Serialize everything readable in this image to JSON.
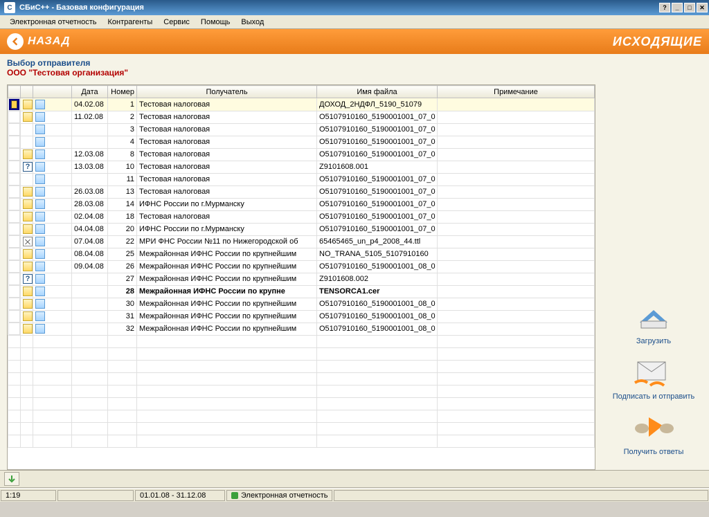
{
  "window": {
    "title": "СБиС++ - Базовая конфигурация"
  },
  "menu": [
    "Электронная отчетность",
    "Контрагенты",
    "Сервис",
    "Помощь",
    "Выход"
  ],
  "header": {
    "back": "НАЗАД",
    "section": "ИСХОДЯЩИЕ"
  },
  "info": {
    "label": "Выбор отправителя",
    "org": "ООО \"Тестовая организация\""
  },
  "columns": {
    "date": "Дата",
    "num": "Номер",
    "recipient": "Получатель",
    "file": "Имя файла",
    "note": "Примечание"
  },
  "rows": [
    {
      "ic1": "doc",
      "date": "04.02.08",
      "num": "1",
      "recipient": "Тестовая налоговая",
      "file": "ДОХОД_2НДФЛ_5190_51079",
      "selected": true
    },
    {
      "ic1": "doc",
      "date": "11.02.08",
      "num": "2",
      "recipient": "Тестовая налоговая",
      "file": "О5107910160_5190001001_07_0"
    },
    {
      "ic1": "",
      "date": "",
      "num": "3",
      "recipient": "Тестовая налоговая",
      "file": "О5107910160_5190001001_07_0"
    },
    {
      "ic1": "",
      "date": "",
      "num": "4",
      "recipient": "Тестовая налоговая",
      "file": "О5107910160_5190001001_07_0"
    },
    {
      "ic1": "doc",
      "date": "12.03.08",
      "num": "8",
      "recipient": "Тестовая налоговая",
      "file": "О5107910160_5190001001_07_0"
    },
    {
      "ic1": "q",
      "date": "13.03.08",
      "num": "10",
      "recipient": "Тестовая налоговая",
      "file": "Z9101608.001"
    },
    {
      "ic1": "",
      "date": "",
      "num": "11",
      "recipient": "Тестовая налоговая",
      "file": "О5107910160_5190001001_07_0"
    },
    {
      "ic1": "doc",
      "date": "26.03.08",
      "num": "13",
      "recipient": "Тестовая налоговая",
      "file": "О5107910160_5190001001_07_0"
    },
    {
      "ic1": "doc",
      "date": "28.03.08",
      "num": "14",
      "recipient": "ИФНС России по г.Мурманску",
      "file": "О5107910160_5190001001_07_0"
    },
    {
      "ic1": "doc",
      "date": "02.04.08",
      "num": "18",
      "recipient": "Тестовая налоговая",
      "file": "О5107910160_5190001001_07_0"
    },
    {
      "ic1": "doc",
      "date": "04.04.08",
      "num": "20",
      "recipient": "ИФНС России по г.Мурманску",
      "file": "О5107910160_5190001001_07_0"
    },
    {
      "ic1": "cross",
      "date": "07.04.08",
      "num": "22",
      "recipient": "МРИ ФНС России №11 по Нижегородской об",
      "file": "65465465_un_p4_2008_44.ttl"
    },
    {
      "ic1": "doc",
      "date": "08.04.08",
      "num": "25",
      "recipient": "Межрайонная ИФНС России по крупнейшим",
      "file": "NO_TRANA_5105_5107910160"
    },
    {
      "ic1": "doc",
      "date": "09.04.08",
      "num": "26",
      "recipient": "Межрайонная ИФНС России по крупнейшим",
      "file": "О5107910160_5190001001_08_0"
    },
    {
      "ic1": "q",
      "date": "",
      "num": "27",
      "recipient": "Межрайонная ИФНС России по крупнейшим",
      "file": "Z9101608.002"
    },
    {
      "ic1": "doc",
      "date": "",
      "num": "28",
      "recipient": "Межрайонная ИФНС России по крупне",
      "file": "TENSORCA1.cer",
      "bold": true
    },
    {
      "ic1": "doc",
      "date": "",
      "num": "30",
      "recipient": "Межрайонная ИФНС России по крупнейшим",
      "file": "О5107910160_5190001001_08_0"
    },
    {
      "ic1": "doc",
      "date": "",
      "num": "31",
      "recipient": "Межрайонная ИФНС России по крупнейшим",
      "file": "О5107910160_5190001001_08_0"
    },
    {
      "ic1": "doc",
      "date": "",
      "num": "32",
      "recipient": "Межрайонная ИФНС России по крупнейшим",
      "file": "О5107910160_5190001001_08_0"
    }
  ],
  "side": {
    "load": "Загрузить",
    "send": "Подписать и отправить",
    "recv": "Получить ответы"
  },
  "status": {
    "pos": "1:19",
    "range": "01.01.08 - 31.12.08",
    "mode": "Электронная отчетность"
  }
}
